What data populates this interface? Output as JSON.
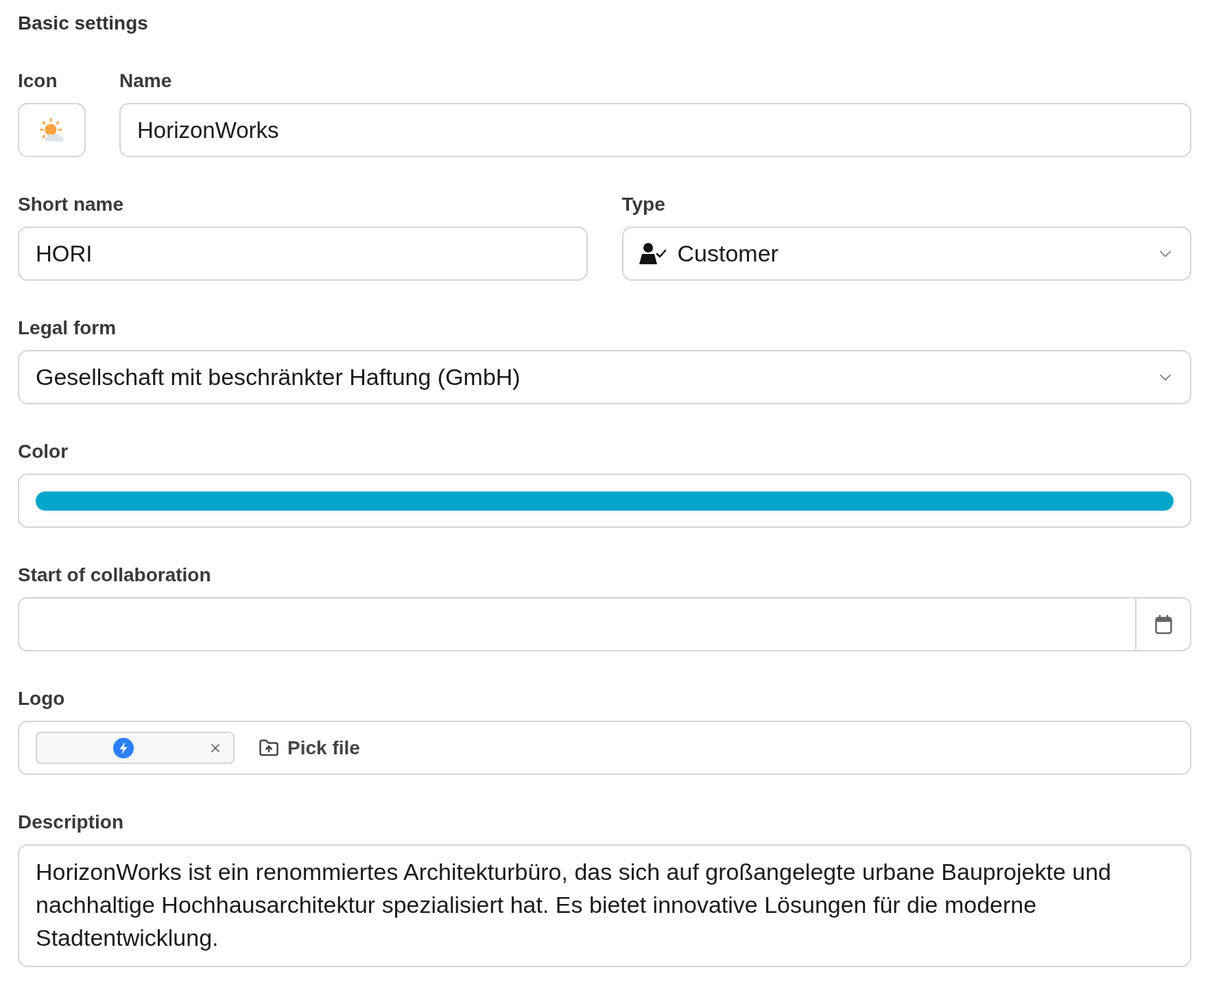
{
  "section": {
    "title": "Basic settings"
  },
  "icon_field": {
    "label": "Icon"
  },
  "name_field": {
    "label": "Name",
    "value": "HorizonWorks"
  },
  "short_name_field": {
    "label": "Short name",
    "value": "HORI"
  },
  "type_field": {
    "label": "Type",
    "value": "Customer"
  },
  "legal_form_field": {
    "label": "Legal form",
    "value": "Gesellschaft mit beschränkter Haftung (GmbH)"
  },
  "color_field": {
    "label": "Color",
    "color": "#01a6cc"
  },
  "start_date_field": {
    "label": "Start of collaboration"
  },
  "logo_field": {
    "label": "Logo",
    "pick_button": "Pick file"
  },
  "description_field": {
    "label": "Description",
    "value": "HorizonWorks ist ein renommiertes Architekturbüro, das sich auf großangelegte urbane Bauprojekte und nachhaltige Hochhausarchitektur spezialisiert hat. Es bietet innovative Lösungen für die moderne Stadtentwicklung."
  }
}
